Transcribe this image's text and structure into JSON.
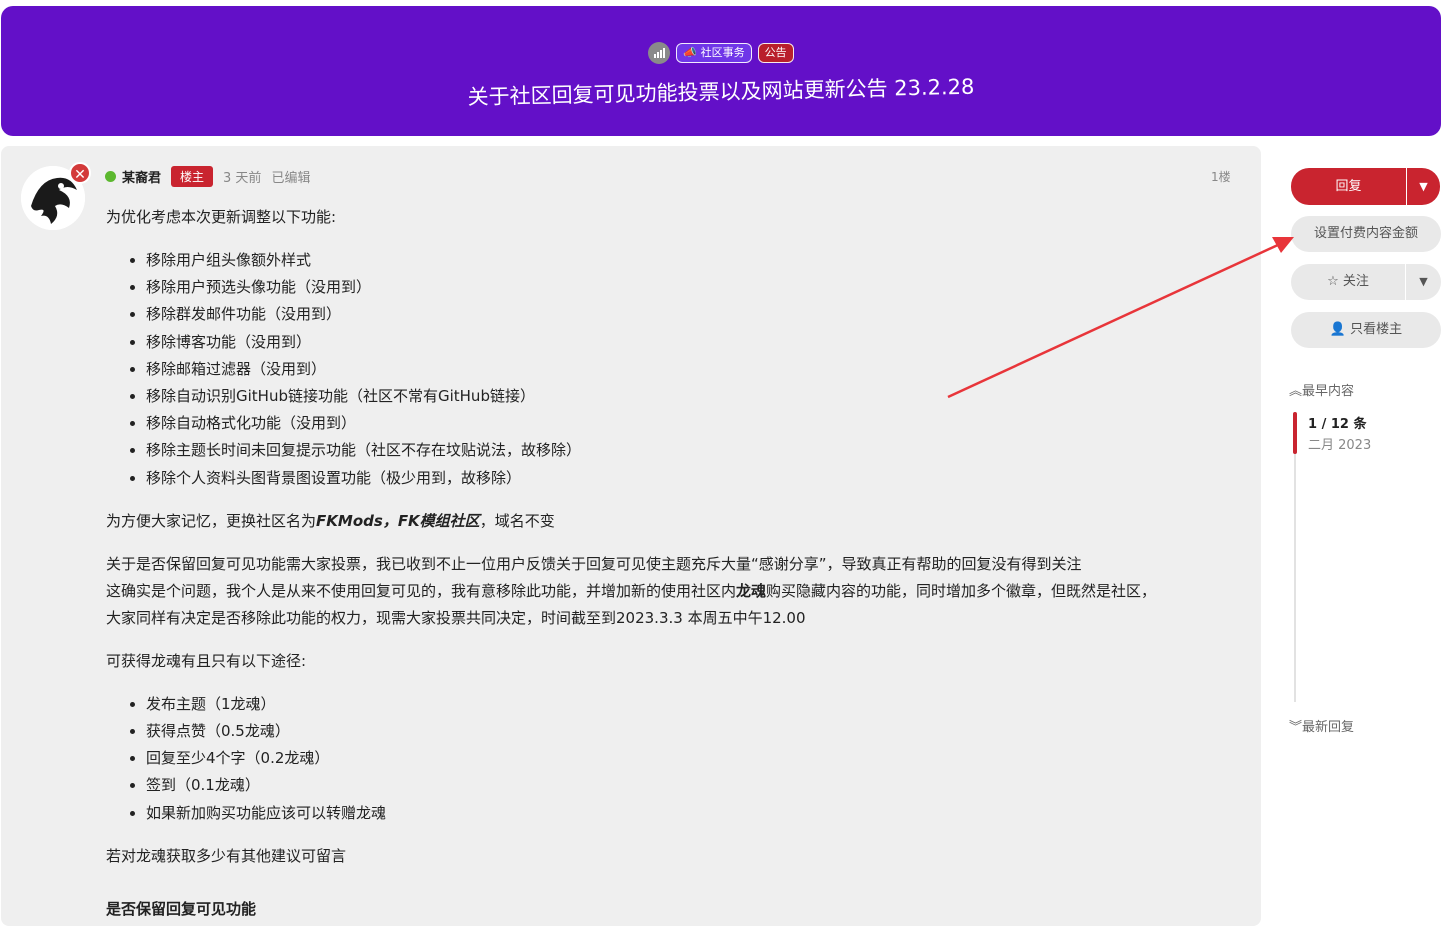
{
  "header": {
    "tags": [
      {
        "label": "社区事务",
        "icon": "megaphone-icon"
      },
      {
        "label": "公告"
      }
    ],
    "title": "关于社区回复可见功能投票以及网站更新公告 23.2.28"
  },
  "post": {
    "username": "某裔君",
    "op_badge": "楼主",
    "time": "3 天前",
    "edited": "已编辑",
    "floor": "1楼",
    "intro": "为优化考虑本次更新调整以下功能:",
    "removed_items": [
      "移除用户组头像额外样式",
      "移除用户预选头像功能（没用到）",
      "移除群发邮件功能（没用到）",
      "移除博客功能（没用到）",
      "移除邮箱过滤器（没用到）",
      "移除自动识别GitHub链接功能（社区不常有GitHub链接）",
      "移除自动格式化功能（没用到）",
      "移除主题长时间未回复提示功能（社区不存在坟贴说法，故移除）",
      "移除个人资料头图背景图设置功能（极少用到，故移除）"
    ],
    "rename": {
      "before": "为方便大家记忆，更换社区名为",
      "name1": "FKMods",
      "sep": "，",
      "name2": "FK模组社区",
      "after": "，域名不变"
    },
    "vote_para": {
      "line1": "关于是否保留回复可见功能需大家投票，我已收到不止一位用户反馈关于回复可见使主题充斥大量“感谢分享”，导致真正有帮助的回复没有得到关注",
      "line2_before": "这确实是个问题，我个人是从来不使用回复可见的，我有意移除此功能，并增加新的使用社区内",
      "line2_bold": "龙魂",
      "line2_after": "购买隐藏内容的功能，同时增加多个徽章，但既然是社区，",
      "line3": "大家同样有决定是否移除此功能的权力，现需大家投票共同决定，时间截至到2023.3.3 本周五中午12.00"
    },
    "soul_intro": "可获得龙魂有且只有以下途径:",
    "soul_items": [
      "发布主题（1龙魂）",
      "获得点赞（0.5龙魂）",
      "回复至少4个字（0.2龙魂）",
      "签到（0.1龙魂）",
      "如果新加购买功能应该可以转赠龙魂"
    ],
    "suggest": "若对龙魂获取多少有其他建议可留言",
    "poll_title": "是否保留回复可见功能"
  },
  "sidebar": {
    "reply_label": "回复",
    "paid_label": "设置付费内容金额",
    "follow_label": "关注",
    "only_op_label": "只看楼主",
    "earliest_label": "最早内容",
    "latest_label": "最新回复",
    "position": "1 / 12 条",
    "date": "二月 2023"
  },
  "colors": {
    "hero": "#6310c8",
    "accent": "#c9242f",
    "online": "#5cb82f",
    "arrow": "#e8353a"
  }
}
